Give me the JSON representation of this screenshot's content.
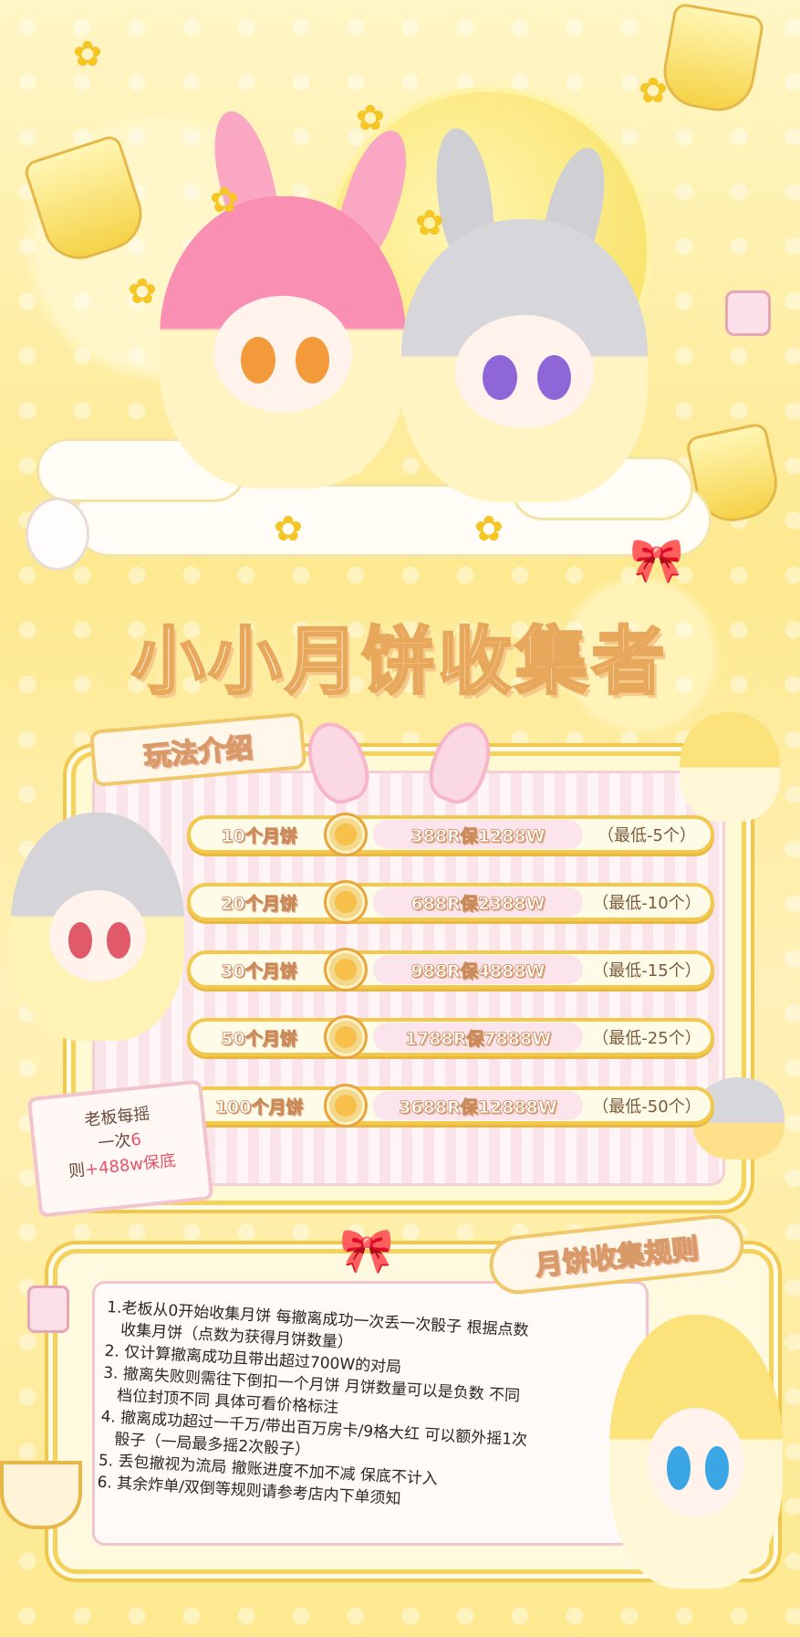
{
  "title": "小小月饼收集者",
  "intro_tag": "玩法介绍",
  "price_rows": [
    {
      "qty": "10个月饼",
      "price": "388R保1288W",
      "min": "（最低-5个）"
    },
    {
      "qty": "20个月饼",
      "price": "688R保2388W",
      "min": "（最低-10个）"
    },
    {
      "qty": "30个月饼",
      "price": "988R保4888W",
      "min": "（最低-15个）"
    },
    {
      "qty": "50个月饼",
      "price": "1788R保7888W",
      "min": "（最低-25个）"
    },
    {
      "qty": "100个月饼",
      "price": "3688R保12888W",
      "min": "（最低-50个）"
    }
  ],
  "note": {
    "line1": "老板每摇",
    "line2_prefix": "一次",
    "line2_value": "6",
    "line3_prefix": "则",
    "line3_value": "+488w保底"
  },
  "rules_tag": "月饼收集规则",
  "rules": [
    "1.老板从0开始收集月饼 每撤离成功一次丢一次骰子 根据点数",
    "   收集月饼（点数为获得月饼数量）",
    "2. 仅计算撤离成功且带出超过700W的对局",
    "3. 撤离失败则需往下倒扣一个月饼 月饼数量可以是负数 不同",
    "   档位封顶不同 具体可看价格标注",
    "4. 撤离成功超过一千万/带出百万房卡/9格大红 可以额外摇1次",
    "   骰子（一局最多摇2次骰子）",
    "5. 丢包撤视为流局 撤账进度不加不减 保底不计入",
    "6. 其余炸单/双倒等规则请参考店内下单须知"
  ],
  "colors": {
    "accent_yellow": "#f4d25b",
    "accent_pink": "#f4a3b8",
    "note_red": "#e6536a"
  }
}
